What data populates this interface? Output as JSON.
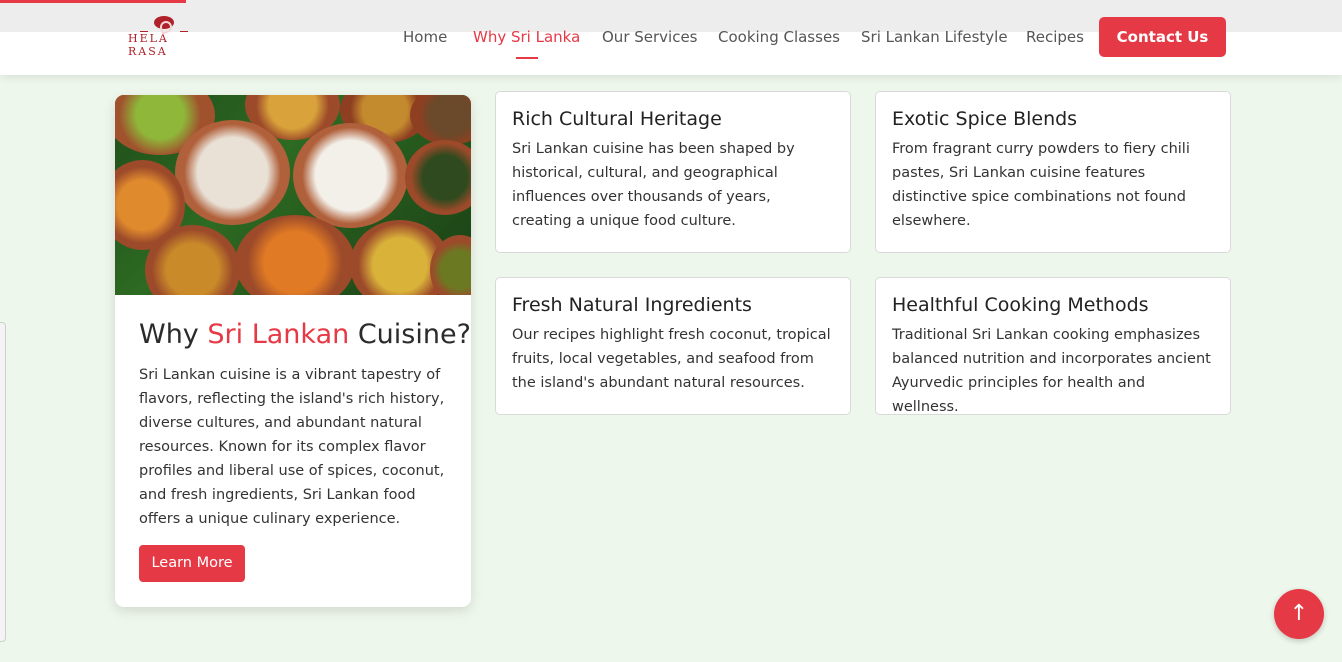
{
  "brand": {
    "logo_text": "HELA RASA",
    "accent_color": "#e63946"
  },
  "nav": {
    "items": [
      {
        "label": "Home"
      },
      {
        "label": "Why Sri Lanka",
        "active": true
      },
      {
        "label": "Our Services"
      },
      {
        "label": "Cooking Classes"
      },
      {
        "label": "Sri Lankan Lifestyle"
      },
      {
        "label": "Recipes"
      }
    ],
    "cta_label": "Contact Us"
  },
  "why": {
    "image_alt": "Sri Lankan rice and curry dishes in clay pots",
    "title_prefix": "Why",
    "title_accent": "Sri Lankan",
    "title_suffix": "Cuisine?",
    "text": "Sri Lankan cuisine is a vibrant tapestry of flavors, reflecting the island's rich history, diverse cultures, and abundant natural resources. Known for its complex flavor profiles and liberal use of spices, coconut, and fresh ingredients, Sri Lankan food offers a unique culinary experience.",
    "button_label": "Learn More"
  },
  "features": [
    {
      "title": "Rich Cultural Heritage",
      "text": "Sri Lankan cuisine has been shaped by historical, cultural, and geographical influences over thousands of years, creating a unique food culture."
    },
    {
      "title": "Exotic Spice Blends",
      "text": "From fragrant curry powders to fiery chili pastes, Sri Lankan cuisine features distinctive spice combinations not found elsewhere."
    },
    {
      "title": "Fresh Natural Ingredients",
      "text": "Our recipes highlight fresh coconut, tropical fruits, local vegetables, and seafood from the island's abundant natural resources."
    },
    {
      "title": "Healthful Cooking Methods",
      "text": "Traditional Sri Lankan cooking emphasizes balanced nutrition and incorporates ancient Ayurvedic principles for health and wellness."
    }
  ],
  "scroll_top": {
    "icon": "arrow-up-icon",
    "glyph": "↑"
  }
}
